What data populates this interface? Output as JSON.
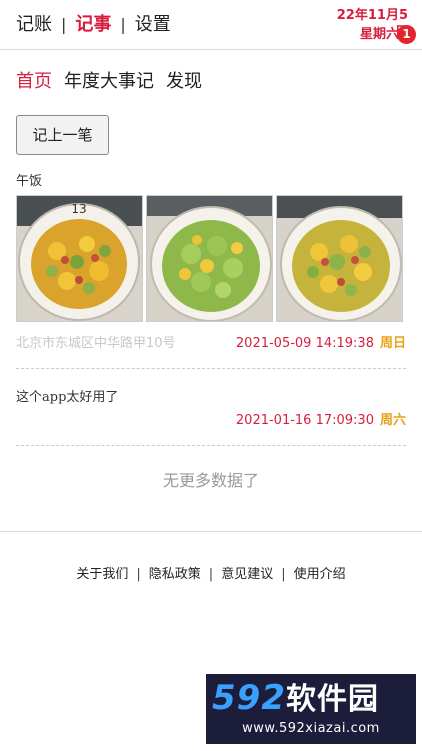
{
  "topnav": {
    "items": [
      {
        "label": "记账"
      },
      {
        "label": "记事",
        "active": true
      },
      {
        "label": "设置"
      }
    ],
    "separator": "|"
  },
  "date": {
    "date_text": "22年11月5日",
    "weekday": "星期六",
    "badge_count": "1"
  },
  "subnav": {
    "items": [
      {
        "label": "首页",
        "active": true
      },
      {
        "label": "年度大事记"
      },
      {
        "label": "发现"
      }
    ]
  },
  "record_button": "记上一笔",
  "entries": [
    {
      "title": "午饭",
      "photo_count": 3,
      "location": "北京市东城区中华路甲10号",
      "timestamp": "2021-05-09 14:19:38",
      "weekday": "周日"
    },
    {
      "title": "这个app太好用了",
      "timestamp": "2021-01-16 17:09:30",
      "weekday": "周六"
    }
  ],
  "no_more": "无更多数据了",
  "footer": {
    "links": [
      "关于我们",
      "隐私政策",
      "意见建议",
      "使用介绍"
    ],
    "separator": "|"
  },
  "watermark": {
    "logo_number": "592",
    "logo_text": "软件园",
    "url": "www.592xiazai.com"
  },
  "colors": {
    "accent": "#d81e3c",
    "weekday": "#e8a21a",
    "muted": "#c8c8c8"
  }
}
